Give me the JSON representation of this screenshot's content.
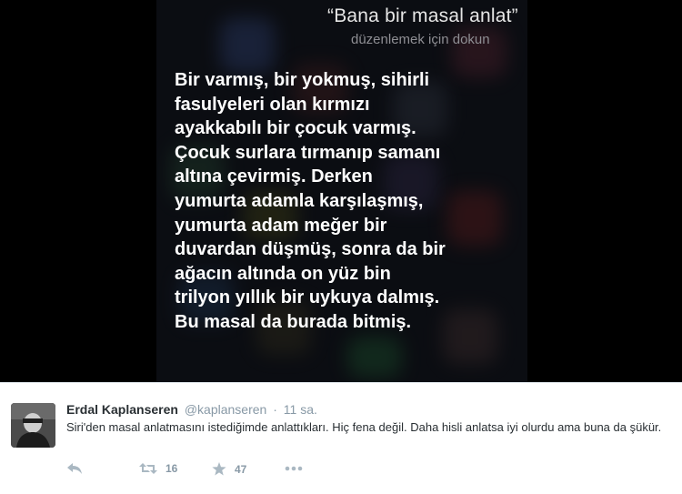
{
  "siri": {
    "query": "“Bana bir masal anlat”",
    "edit_hint": "düzenlemek için dokun",
    "answer": "Bir varmış, bir yokmuş, sihirli\nfasulyeleri olan kırmızı\nayakkabılı bir çocuk varmış.\nÇocuk surlara tırmanıp samanı\naltına çevirmiş. Derken\nyumurta adamla karşılaşmış,\nyumurta adam meğer bir\nduvardan düşmüş, sonra da bir\nağacın altında on yüz bin\ntrilyon yıllık bir uykuya dalmış.\nBu masal da burada bitmiş."
  },
  "tweet": {
    "author_name": "Erdal Kaplanseren",
    "handle": "@kaplanseren",
    "separator": "·",
    "time": "11 sa.",
    "text": "Siri'den masal anlatmasını istediğimde anlattıkları. Hiç fena değil. Daha hisli anlatsa iyi olurdu ama buna da şükür.",
    "retweets": "16",
    "likes": "47",
    "icons": {
      "reply": "reply-icon",
      "retweet": "retweet-icon",
      "like": "star-icon",
      "more": "more-icon"
    }
  },
  "colors": {
    "media_bg": "#000000",
    "siri_text": "#ffffff",
    "siri_hint": "#8e8e93",
    "tweet_text": "#292f33",
    "meta": "#8899a6",
    "icon": "#aab8c2"
  }
}
